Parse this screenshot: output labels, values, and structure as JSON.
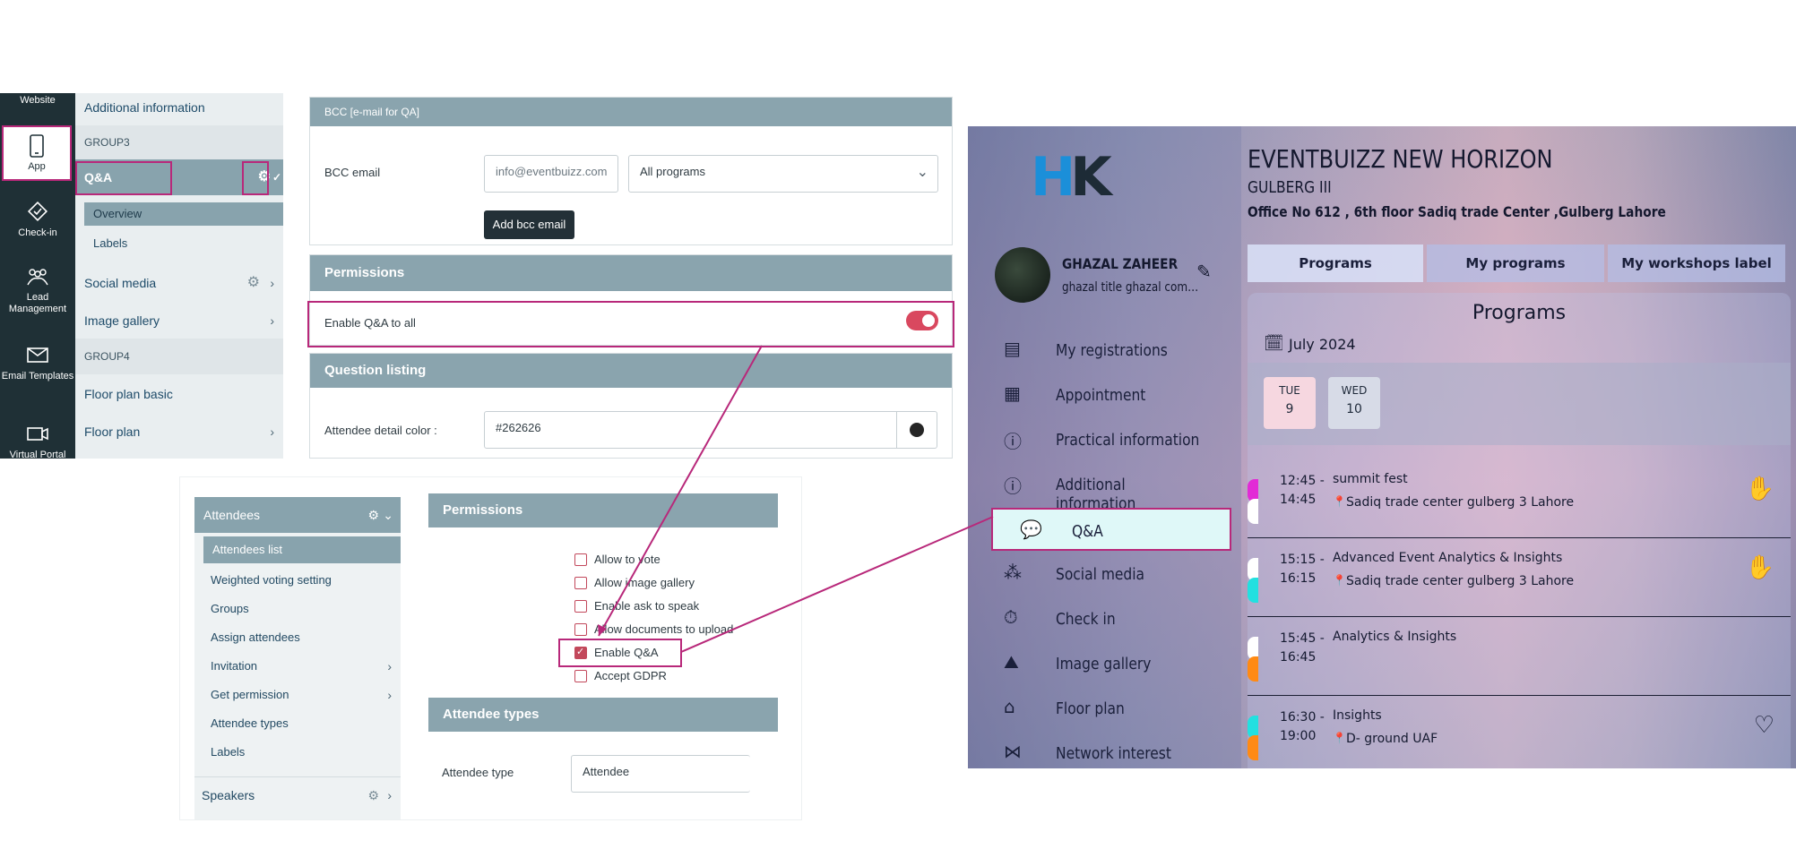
{
  "sidebar": {
    "items": [
      {
        "label": "Website"
      },
      {
        "label": "App"
      },
      {
        "label": "Check-in"
      },
      {
        "label": "Lead Management"
      },
      {
        "label": "Email Templates"
      },
      {
        "label": "Virtual Portal"
      }
    ]
  },
  "subnav": {
    "additional_info": "Additional information",
    "group3": "GROUP3",
    "qa": "Q&A",
    "overview": "Overview",
    "labels": "Labels",
    "social_media": "Social media",
    "image_gallery": "Image gallery",
    "group4": "GROUP4",
    "floor_plan_basic": "Floor plan basic",
    "floor_plan": "Floor plan"
  },
  "settings": {
    "bcc_header": "BCC [e-mail for QA]",
    "bcc_label": "BCC email",
    "bcc_placeholder": "info@eventbuizz.com",
    "programs_select": "All programs",
    "add_bcc": "Add bcc email",
    "permissions_header": "Permissions",
    "enable_qa_all": "Enable Q&A to all",
    "question_listing_header": "Question listing",
    "attendee_color_label": "Attendee detail color :",
    "attendee_color_value": "#262626"
  },
  "attendees_panel": {
    "section": "Attendees",
    "items": [
      "Attendees list",
      "Weighted voting setting",
      "Groups",
      "Assign attendees",
      "Invitation",
      "Get permission",
      "Attendee types",
      "Labels"
    ],
    "speakers": "Speakers",
    "permissions_header": "Permissions",
    "checkboxes": [
      {
        "label": "Allow to vote",
        "checked": false
      },
      {
        "label": "Allow image gallery",
        "checked": false
      },
      {
        "label": "Enable ask to speak",
        "checked": false
      },
      {
        "label": "Allow documents to upload",
        "checked": false
      },
      {
        "label": "Enable Q&A",
        "checked": true
      },
      {
        "label": "Accept GDPR",
        "checked": false
      }
    ],
    "attendee_types_header": "Attendee types",
    "attendee_type_label": "Attendee type",
    "attendee_type_value": "Attendee"
  },
  "app": {
    "logo_h": "H",
    "logo_k": "K",
    "event_title": "EVENTBUIZZ NEW HORIZON",
    "location": "GULBERG III",
    "address": "Office No 612 , 6th floor Sadiq trade Center ,Gulberg Lahore",
    "user_name": "GHAZAL ZAHEER",
    "user_subtitle": "ghazal title ghazal com…",
    "menu": [
      {
        "label": "My registrations",
        "icon": "registration-icon"
      },
      {
        "label": "Appointment",
        "icon": "calendar-check-icon"
      },
      {
        "label": "Practical information",
        "icon": "info-icon"
      },
      {
        "label": "Additional information",
        "icon": "info-icon"
      },
      {
        "label": "Q&A",
        "icon": "chat-bubbles-icon"
      },
      {
        "label": "Social media",
        "icon": "social-icon"
      },
      {
        "label": "Check in",
        "icon": "checkin-icon"
      },
      {
        "label": "Image gallery",
        "icon": "gallery-icon"
      },
      {
        "label": "Floor plan",
        "icon": "floor-plan-icon"
      },
      {
        "label": "Network interest",
        "icon": "network-icon"
      }
    ],
    "tabs": [
      "Programs",
      "My programs",
      "My workshops label"
    ],
    "programs_title": "Programs",
    "month": "July 2024",
    "days": [
      {
        "dow": "TUE",
        "num": "9",
        "selected": true
      },
      {
        "dow": "WED",
        "num": "10",
        "selected": false
      }
    ],
    "programs": [
      {
        "start": "12:45 -",
        "end": "14:45",
        "title": "summit fest",
        "location": "Sadiq trade center gulberg 3 Lahore",
        "color_top": "#e22bd6",
        "color_bottom": "#ffffff",
        "action": "raise-hand-icon",
        "action_glyph": "✋"
      },
      {
        "start": "15:15 -",
        "end": "16:15",
        "title": "Advanced Event Analytics & Insights",
        "location": "Sadiq trade center gulberg 3 Lahore",
        "color_top": "#ffffff",
        "color_bottom": "#22e0e0",
        "action": "raise-hand-icon",
        "action_glyph": "✋"
      },
      {
        "start": "15:45 -",
        "end": "16:45",
        "title": "Analytics & Insights",
        "location": "",
        "color_top": "#ffffff",
        "color_bottom": "#ff8a14",
        "action": "",
        "action_glyph": ""
      },
      {
        "start": "16:30 -",
        "end": "19:00",
        "title": "Insights",
        "location": "D- ground UAF",
        "color_top": "#22e0e0",
        "color_bottom": "#ff8a14",
        "action": "heart-icon",
        "action_glyph": "♡"
      }
    ]
  }
}
